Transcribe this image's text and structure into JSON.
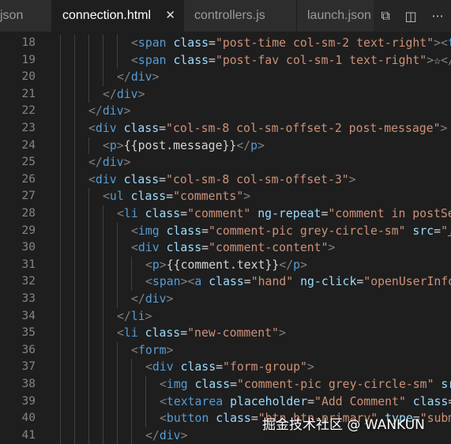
{
  "tabs": [
    {
      "label": "json",
      "active": false
    },
    {
      "label": "connection.html",
      "active": true
    },
    {
      "label": "controllers.js",
      "active": false
    },
    {
      "label": "launch.json",
      "active": false
    }
  ],
  "tab_close_glyph": "✕",
  "toolbar": {
    "icons": [
      "open-changes-icon",
      "split-editor-icon",
      "more-actions-icon"
    ],
    "glyphs": [
      "⧉",
      "◫",
      "···"
    ]
  },
  "colors": {
    "background": "#1e1e1e",
    "tag": "#569cd6",
    "attribute": "#9cdcfe",
    "string": "#ce9178",
    "text": "#d4d4d4",
    "line_number": "#858585"
  },
  "editor": {
    "lines": [
      {
        "n": "18",
        "indent": 6,
        "tokens": [
          [
            "punc",
            "<"
          ],
          [
            "tag",
            "span"
          ],
          [
            "text",
            " "
          ],
          [
            "attr",
            "class"
          ],
          [
            "text",
            "="
          ],
          [
            "str",
            "\"post-time col-sm-2 text-right\""
          ],
          [
            "punc",
            ">"
          ],
          [
            "punc",
            "<"
          ],
          [
            "tag",
            "ti"
          ]
        ]
      },
      {
        "n": "19",
        "indent": 6,
        "tokens": [
          [
            "punc",
            "<"
          ],
          [
            "tag",
            "span"
          ],
          [
            "text",
            " "
          ],
          [
            "attr",
            "class"
          ],
          [
            "text",
            "="
          ],
          [
            "str",
            "\"post-fav col-sm-1 text-right\""
          ],
          [
            "punc",
            ">"
          ],
          [
            "text",
            "☆"
          ],
          [
            "punc",
            "</"
          ],
          [
            "tag",
            "s"
          ]
        ]
      },
      {
        "n": "20",
        "indent": 5,
        "tokens": [
          [
            "punc",
            "</"
          ],
          [
            "tag",
            "div"
          ],
          [
            "punc",
            ">"
          ]
        ]
      },
      {
        "n": "21",
        "indent": 4,
        "tokens": [
          [
            "punc",
            "</"
          ],
          [
            "tag",
            "div"
          ],
          [
            "punc",
            ">"
          ]
        ]
      },
      {
        "n": "22",
        "indent": 3,
        "tokens": [
          [
            "punc",
            "</"
          ],
          [
            "tag",
            "div"
          ],
          [
            "punc",
            ">"
          ]
        ]
      },
      {
        "n": "23",
        "indent": 3,
        "tokens": [
          [
            "punc",
            "<"
          ],
          [
            "tag",
            "div"
          ],
          [
            "text",
            " "
          ],
          [
            "attr",
            "class"
          ],
          [
            "text",
            "="
          ],
          [
            "str",
            "\"col-sm-8 col-sm-offset-2 post-message\""
          ],
          [
            "punc",
            ">"
          ]
        ]
      },
      {
        "n": "24",
        "indent": 4,
        "tokens": [
          [
            "punc",
            "<"
          ],
          [
            "tag",
            "p"
          ],
          [
            "punc",
            ">"
          ],
          [
            "text",
            "{{post.message}}"
          ],
          [
            "punc",
            "</"
          ],
          [
            "tag",
            "p"
          ],
          [
            "punc",
            ">"
          ]
        ]
      },
      {
        "n": "25",
        "indent": 3,
        "tokens": [
          [
            "punc",
            "</"
          ],
          [
            "tag",
            "div"
          ],
          [
            "punc",
            ">"
          ]
        ]
      },
      {
        "n": "26",
        "indent": 3,
        "tokens": [
          [
            "punc",
            "<"
          ],
          [
            "tag",
            "div"
          ],
          [
            "text",
            " "
          ],
          [
            "attr",
            "class"
          ],
          [
            "text",
            "="
          ],
          [
            "str",
            "\"col-sm-8 col-sm-offset-3\""
          ],
          [
            "punc",
            ">"
          ]
        ]
      },
      {
        "n": "27",
        "indent": 4,
        "tokens": [
          [
            "punc",
            "<"
          ],
          [
            "tag",
            "ul"
          ],
          [
            "text",
            " "
          ],
          [
            "attr",
            "class"
          ],
          [
            "text",
            "="
          ],
          [
            "str",
            "\"comments\""
          ],
          [
            "punc",
            ">"
          ]
        ]
      },
      {
        "n": "28",
        "indent": 5,
        "tokens": [
          [
            "punc",
            "<"
          ],
          [
            "tag",
            "li"
          ],
          [
            "text",
            " "
          ],
          [
            "attr",
            "class"
          ],
          [
            "text",
            "="
          ],
          [
            "str",
            "\"comment\""
          ],
          [
            "text",
            " "
          ],
          [
            "attr",
            "ng-repeat"
          ],
          [
            "text",
            "="
          ],
          [
            "str",
            "\"comment in postSer"
          ]
        ]
      },
      {
        "n": "29",
        "indent": 6,
        "tokens": [
          [
            "punc",
            "<"
          ],
          [
            "tag",
            "img"
          ],
          [
            "text",
            " "
          ],
          [
            "attr",
            "class"
          ],
          [
            "text",
            "="
          ],
          [
            "str",
            "\"comment-pic grey-circle-sm\""
          ],
          [
            "text",
            " "
          ],
          [
            "attr",
            "src"
          ],
          [
            "text",
            "="
          ],
          [
            "str",
            "\""
          ],
          [
            "link",
            "..."
          ]
        ]
      },
      {
        "n": "30",
        "indent": 6,
        "tokens": [
          [
            "punc",
            "<"
          ],
          [
            "tag",
            "div"
          ],
          [
            "text",
            " "
          ],
          [
            "attr",
            "class"
          ],
          [
            "text",
            "="
          ],
          [
            "str",
            "\"comment-content\""
          ],
          [
            "punc",
            ">"
          ]
        ]
      },
      {
        "n": "31",
        "indent": 7,
        "tokens": [
          [
            "punc",
            "<"
          ],
          [
            "tag",
            "p"
          ],
          [
            "punc",
            ">"
          ],
          [
            "text",
            "{{comment.text}}"
          ],
          [
            "punc",
            "</"
          ],
          [
            "tag",
            "p"
          ],
          [
            "punc",
            ">"
          ]
        ]
      },
      {
        "n": "32",
        "indent": 7,
        "tokens": [
          [
            "punc",
            "<"
          ],
          [
            "tag",
            "span"
          ],
          [
            "punc",
            ">"
          ],
          [
            "punc",
            "<"
          ],
          [
            "tag",
            "a"
          ],
          [
            "text",
            " "
          ],
          [
            "attr",
            "class"
          ],
          [
            "text",
            "="
          ],
          [
            "str",
            "\"hand\""
          ],
          [
            "text",
            " "
          ],
          [
            "attr",
            "ng-click"
          ],
          [
            "text",
            "="
          ],
          [
            "str",
            "\"openUserInfo("
          ]
        ]
      },
      {
        "n": "33",
        "indent": 6,
        "tokens": [
          [
            "punc",
            "</"
          ],
          [
            "tag",
            "div"
          ],
          [
            "punc",
            ">"
          ]
        ]
      },
      {
        "n": "34",
        "indent": 5,
        "tokens": [
          [
            "punc",
            "</"
          ],
          [
            "tag",
            "li"
          ],
          [
            "punc",
            ">"
          ]
        ]
      },
      {
        "n": "35",
        "indent": 5,
        "tokens": [
          [
            "punc",
            "<"
          ],
          [
            "tag",
            "li"
          ],
          [
            "text",
            " "
          ],
          [
            "attr",
            "class"
          ],
          [
            "text",
            "="
          ],
          [
            "str",
            "\"new-comment\""
          ],
          [
            "punc",
            ">"
          ]
        ]
      },
      {
        "n": "36",
        "indent": 6,
        "tokens": [
          [
            "punc",
            "<"
          ],
          [
            "tag",
            "form"
          ],
          [
            "punc",
            ">"
          ]
        ]
      },
      {
        "n": "37",
        "indent": 7,
        "tokens": [
          [
            "punc",
            "<"
          ],
          [
            "tag",
            "div"
          ],
          [
            "text",
            " "
          ],
          [
            "attr",
            "class"
          ],
          [
            "text",
            "="
          ],
          [
            "str",
            "\"form-group\""
          ],
          [
            "punc",
            ">"
          ]
        ]
      },
      {
        "n": "38",
        "indent": 8,
        "tokens": [
          [
            "punc",
            "<"
          ],
          [
            "tag",
            "img"
          ],
          [
            "text",
            " "
          ],
          [
            "attr",
            "class"
          ],
          [
            "text",
            "="
          ],
          [
            "str",
            "\"comment-pic grey-circle-sm\""
          ],
          [
            "text",
            " "
          ],
          [
            "attr",
            "src"
          ]
        ]
      },
      {
        "n": "39",
        "indent": 8,
        "tokens": [
          [
            "punc",
            "<"
          ],
          [
            "tag",
            "textarea"
          ],
          [
            "text",
            " "
          ],
          [
            "attr",
            "placeholder"
          ],
          [
            "text",
            "="
          ],
          [
            "str",
            "\"Add Comment\""
          ],
          [
            "text",
            " "
          ],
          [
            "attr",
            "class"
          ],
          [
            "text",
            "=\""
          ]
        ]
      },
      {
        "n": "40",
        "indent": 8,
        "tokens": [
          [
            "punc",
            "<"
          ],
          [
            "tag",
            "button"
          ],
          [
            "text",
            " "
          ],
          [
            "attr",
            "class"
          ],
          [
            "text",
            "="
          ],
          [
            "str",
            "\"btn btn-primary\""
          ],
          [
            "text",
            " "
          ],
          [
            "attr",
            "type"
          ],
          [
            "text",
            "="
          ],
          [
            "str",
            "\"submi"
          ]
        ]
      },
      {
        "n": "41",
        "indent": 7,
        "tokens": [
          [
            "punc",
            "</"
          ],
          [
            "tag",
            "div"
          ],
          [
            "punc",
            ">"
          ]
        ]
      }
    ]
  },
  "watermark": "掘金技术社区 @ WANKUN"
}
